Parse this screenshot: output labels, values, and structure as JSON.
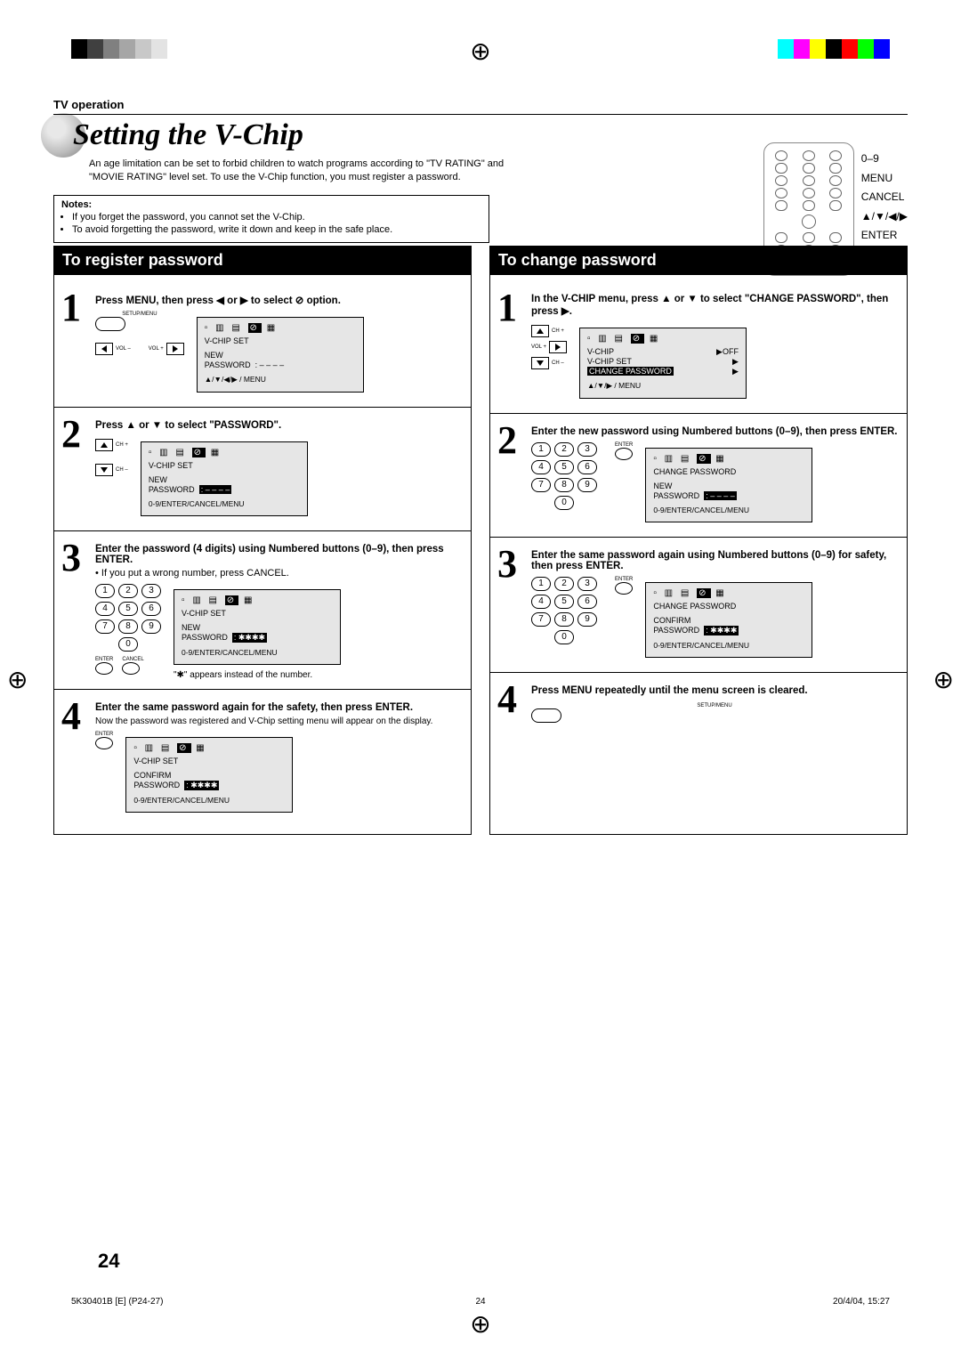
{
  "sectionHead": "TV operation",
  "title": "Setting the V-Chip",
  "intro": "An age limitation can be set to forbid children to watch programs according to \"TV RATING\" and \"MOVIE RATING\" level set. To use the V-Chip function, you must register a password.",
  "notesHead": "Notes:",
  "notes": [
    "If you forget the password, you cannot set the V-Chip.",
    "To avoid forgetting the password, write it down and keep in the safe place."
  ],
  "remoteLabels": [
    "0–9",
    "MENU",
    "CANCEL",
    "▲/▼/◀/▶",
    "ENTER"
  ],
  "leftTitle": "To register password",
  "rightTitle": "To change password",
  "left": {
    "s1": "Press MENU, then press ◀ or ▶ to select ⊘ option.",
    "s2": "Press ▲ or ▼ to select \"PASSWORD\".",
    "s3": "Enter the password (4 digits) using Numbered buttons (0–9), then press ENTER.",
    "s3sub": "If you put a wrong number, press CANCEL.",
    "s3note": "\"✱\" appears instead of the number.",
    "s4": "Enter the same password again for the safety, then press ENTER.",
    "s4sub": "Now the password was registered and V-Chip setting menu will appear on the display."
  },
  "right": {
    "s1": "In the V-CHIP menu, press ▲ or ▼ to select \"CHANGE PASSWORD\", then press ▶.",
    "s2": "Enter the new password using Numbered buttons (0–9), then press ENTER.",
    "s3": "Enter the same password again using Numbered buttons (0–9) for safety, then press ENTER.",
    "s4": "Press MENU repeatedly until the menu screen is cleared."
  },
  "screens": {
    "l1": {
      "t": "V-CHIP SET",
      "r1": "NEW",
      "r2": "PASSWORD",
      "v": ": – – – –",
      "f": "▲/▼/◀/▶ / MENU"
    },
    "l2": {
      "t": "V-CHIP SET",
      "r1": "NEW",
      "r2": "PASSWORD",
      "v": ": – – – –",
      "f": "0-9/ENTER/CANCEL/MENU"
    },
    "l3": {
      "t": "V-CHIP SET",
      "r1": "NEW",
      "r2": "PASSWORD",
      "v": ": ✱✱✱✱",
      "f": "0-9/ENTER/CANCEL/MENU"
    },
    "l4": {
      "t": "V-CHIP SET",
      "r1": "CONFIRM",
      "r2": "PASSWORD",
      "v": ": ✱✱✱✱",
      "f": "0-9/ENTER/CANCEL/MENU"
    },
    "r1": {
      "r1": "V-CHIP",
      "v1": "▶OFF",
      "r2": "V-CHIP SET",
      "v2": "▶",
      "r3": "CHANGE PASSWORD",
      "v3": "▶",
      "f": "▲/▼/▶ / MENU"
    },
    "r2": {
      "t": "CHANGE  PASSWORD",
      "r1": "NEW",
      "r2": "PASSWORD",
      "v": ": – – – –",
      "f": "0-9/ENTER/CANCEL/MENU"
    },
    "r3": {
      "t": "CHANGE  PASSWORD",
      "r1": "CONFIRM",
      "r2": "PASSWORD",
      "v": ": ✱✱✱✱",
      "f": "0-9/ENTER/CANCEL/MENU"
    }
  },
  "keypad": [
    "1",
    "2",
    "3",
    "4",
    "5",
    "6",
    "7",
    "8",
    "9",
    "0"
  ],
  "pageNum": "24",
  "footer": {
    "l": "5K30401B [E] (P24-27)",
    "c": "24",
    "r": "20/4/04, 15:27"
  },
  "btnSetupMenu": "SETUP/MENU",
  "btnEnter": "ENTER",
  "btnCancel": "CANCEL",
  "btnVolMinus": "VOL –",
  "btnVolPlus": "VOL +",
  "btnChPlus": "CH +",
  "btnChMinus": "CH –"
}
